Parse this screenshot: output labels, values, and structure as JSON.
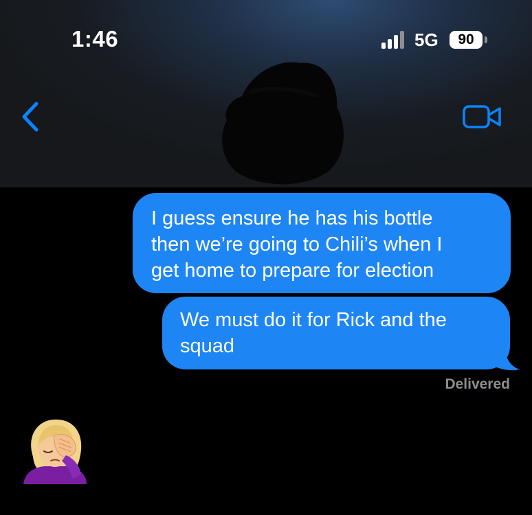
{
  "status_bar": {
    "time": "1:46",
    "network": "5G",
    "battery_level": "90"
  },
  "header": {
    "back_icon": "chevron-left-icon",
    "video_icon": "video-camera-icon",
    "accent_color": "#0a84ff"
  },
  "messages": [
    {
      "sender": "me",
      "lines": [
        "I guess ensure he has his bottle",
        "then we’re going to Chili’s when I",
        "get home to prepare for election"
      ]
    },
    {
      "sender": "me",
      "lines": [
        "We must do it for Rick and the",
        "squad"
      ]
    }
  ],
  "delivery_status": "Delivered",
  "reply_emoji": "woman-facepalming-icon",
  "colors": {
    "bubble": "#1e85f5",
    "background": "#000000",
    "status_text": "#8e8e93"
  }
}
